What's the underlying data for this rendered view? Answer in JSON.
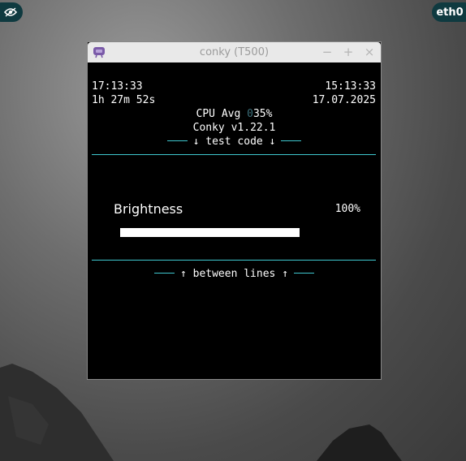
{
  "panel": {
    "left_icon": "eye-icon",
    "right_label": "eth0"
  },
  "window": {
    "title": "conky (T500)",
    "icon": "conky-app-icon",
    "buttons": {
      "minimize": "−",
      "maximize": "+",
      "close": "×"
    }
  },
  "conky": {
    "local_time": "17:13:33",
    "utc_time": "15:13:33",
    "uptime": "1h 27m 52s",
    "date": "17.07.2025",
    "cpu_label": "CPU Avg ",
    "cpu_leading_zero": "0",
    "cpu_value": "35%",
    "version": "Conky v1.22.1",
    "test_code_header": "↓ test code ↓",
    "brightness_label": "Brightness",
    "brightness_percent": "100%",
    "brightness_fill": 1.0,
    "between_lines": "↑ between lines ↑"
  },
  "colors": {
    "accent_line": "#3fc7cf",
    "panel_pill": "#0f3a40",
    "cpu_zero_dim": "#3b6f7a"
  }
}
